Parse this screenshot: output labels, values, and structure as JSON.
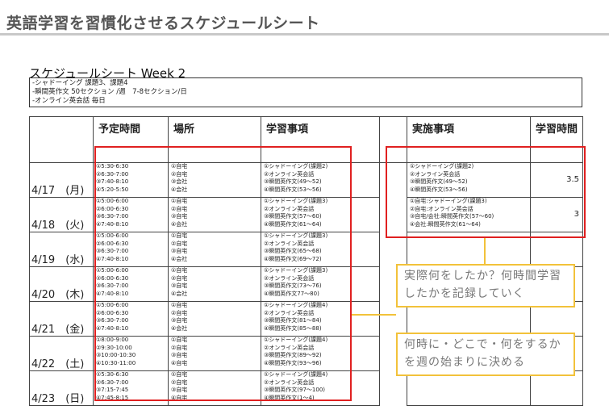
{
  "page": {
    "title": "英語学習を習慣化させるスケジュールシート"
  },
  "sheet": {
    "title": "スケジュールシート Week 2",
    "goals": [
      "-シャドーイング 課題3、課題4",
      "-瞬間英作文 50セクション /週　7-8セクション/日",
      "-オンライン英会話 毎日"
    ]
  },
  "table": {
    "headers": [
      "",
      "予定時間",
      "場所",
      "学習事項",
      "",
      "実施事項",
      "学習時間"
    ],
    "rows": [
      {
        "date": "4/17　(月)",
        "times": [
          "①5:30-6:30",
          "②6:30-7:00",
          "③7:40-8:10",
          "④5:20-5:50"
        ],
        "places": [
          "①自宅",
          "②自宅",
          "③会社",
          "④会社"
        ],
        "items": [
          "①シャドーイング(課題2)",
          "②オンライン英会話",
          "③瞬間英作文(49～52)",
          "④瞬間英作文(53～56)"
        ],
        "done": [
          "①シャドーイング(課題2)",
          "②オンライン英会話",
          "③瞬間英作文(49～52)",
          "④瞬間英作文(53～56)"
        ],
        "hours": "3.5"
      },
      {
        "date": "4/18　(火)",
        "times": [
          "①5:00-6:00",
          "②6:00-6:30",
          "③6:30-7:00",
          "④7:40-8:10"
        ],
        "places": [
          "①自宅",
          "②自宅",
          "③自宅",
          "④会社"
        ],
        "items": [
          "①シャドーイング(課題3)",
          "②オンライン英会話",
          "③瞬間英作文(57～60)",
          "④瞬間英作文(61～64)"
        ],
        "done": [
          "①自宅:シャドーイング(課題3)",
          "②自宅:オンライン英会話",
          "③自宅/会社:瞬間英作文(57～60)",
          "④会社:瞬間英作文(61～64)"
        ],
        "hours": "3"
      },
      {
        "date": "4/19　(水)",
        "times": [
          "①5:00-6:00",
          "②6:00-6:30",
          "③6:30-7:00",
          "④7:40-8:10"
        ],
        "places": [
          "①自宅",
          "②自宅",
          "③自宅",
          "④会社"
        ],
        "items": [
          "①シャドーイング(課題3)",
          "②オンライン英会話",
          "③瞬間英作文(65～68)",
          "④瞬間英作文(69～72)"
        ],
        "done": [],
        "hours": ""
      },
      {
        "date": "4/20　(木)",
        "times": [
          "①5:00-6:00",
          "②6:00-6:30",
          "③6:30-7:00",
          "④7:40-8:10"
        ],
        "places": [
          "①自宅",
          "②自宅",
          "③自宅",
          "④会社"
        ],
        "items": [
          "①シャドーイング(課題3)",
          "②オンライン英会話",
          "③瞬間英作文(73～76)",
          "④瞬間英作文77～80)"
        ],
        "done": [],
        "hours": ""
      },
      {
        "date": "4/21　(金)",
        "times": [
          "①5:00-6:00",
          "②6:00-6:30",
          "③6:30-7:00",
          "④7:40-8:10"
        ],
        "places": [
          "①自宅",
          "②自宅",
          "③自宅",
          "④会社"
        ],
        "items": [
          "①シャドーイング(課題4)",
          "②オンライン英会話",
          "③瞬間英作文(81～84)",
          "④瞬間英作文(85～88)"
        ],
        "done": [],
        "hours": ""
      },
      {
        "date": "4/22　(土)",
        "times": [
          "①8:00-9:00",
          "②9:30-10:00",
          "③10:00-10:30",
          "④10:30-11:00"
        ],
        "places": [
          "①自宅",
          "②自宅",
          "③自宅",
          "④自宅"
        ],
        "items": [
          "①シャドーイング(課題4)",
          "②オンライン英会話",
          "③瞬間英作文(89～92)",
          "④瞬間英作文(93～96)"
        ],
        "done": [],
        "hours": ""
      },
      {
        "date": "4/23　(日)",
        "times": [
          "①5:30-6:30",
          "②6:30-7:00",
          "③7:15-7:45",
          "④7:45-8:15"
        ],
        "places": [
          "①自宅",
          "②自宅",
          "③自宅",
          "④自宅"
        ],
        "items": [
          "①シャドーイング(課題4)",
          "②オンライン英会話",
          "③瞬間英作文(97～100)",
          "④瞬間英作文(1～4)"
        ],
        "done": [],
        "hours": ""
      }
    ]
  },
  "notes": {
    "actual": "実際何をしたか？何時間学習したかを記録していく",
    "plan": "何時に・どこで・何をするかを週の始まりに決める"
  },
  "colors": {
    "highlight": "#e02020",
    "callout": "#f2c23a"
  }
}
